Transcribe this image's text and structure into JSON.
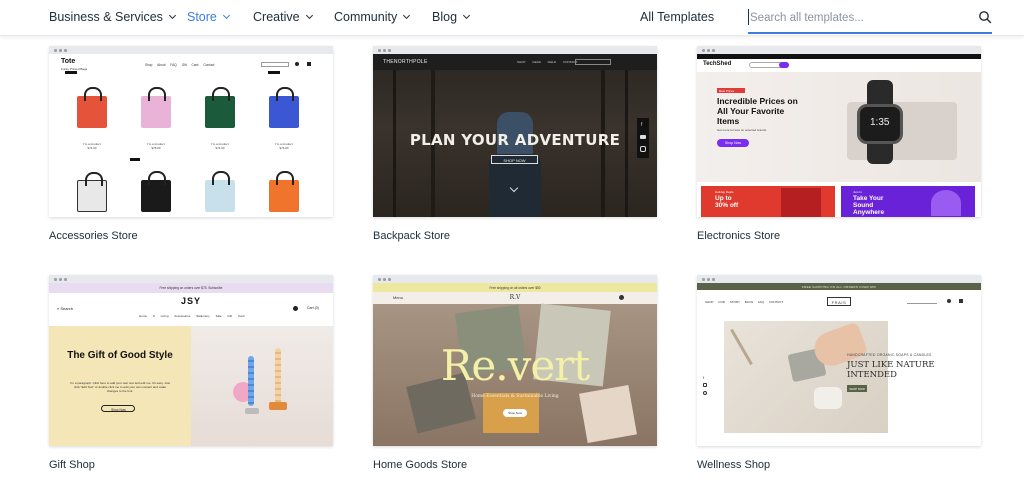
{
  "nav": {
    "items": [
      {
        "label": "Business & Services"
      },
      {
        "label": "Store"
      },
      {
        "label": "Creative"
      },
      {
        "label": "Community"
      },
      {
        "label": "Blog"
      }
    ],
    "active": "Store",
    "all_templates": "All Templates",
    "search_placeholder": "Search all templates...",
    "accent": "#3b7de0"
  },
  "templates": [
    {
      "title": "Accessories Store",
      "site": {
        "brand": "Tote",
        "tagline": "Funky Printed Bags",
        "menu": [
          "Shop",
          "About",
          "FAQ",
          "Gift Card",
          "Contact"
        ],
        "product_name": "I'm a product",
        "prices": [
          "$74.00",
          "$78.00",
          "$74.00",
          "$76.00"
        ]
      }
    },
    {
      "title": "Backpack Store",
      "site": {
        "brand": "THENORTHPOLE",
        "menu": [
          "SHOP",
          "GEAR",
          "FIELD",
          "CONTACT"
        ],
        "hero": "PLAN YOUR ADVENTURE",
        "cta": "SHOP NOW"
      }
    },
    {
      "title": "Electronics Store",
      "site": {
        "brand": "TechShed",
        "badge": "Best Prices",
        "headline": "Incredible Prices on All Your Favorite Items",
        "sub": "Get more for less on selected brands",
        "cta": "Shop Now",
        "watch_time": "1:35",
        "promo1_tag": "Holiday Deals",
        "promo1": "Up to 30% off",
        "promo2_tag": "Just In",
        "promo2": "Take Your Sound Anywhere"
      }
    },
    {
      "title": "Gift Shop",
      "site": {
        "banner": "Free shipping on orders over $75. Subscribe",
        "brand": "JSY",
        "search": "Search",
        "cart": "Cart (0)",
        "menu": [
          "Home & Living",
          "Accessories",
          "Stationery",
          "Sale",
          "Gift Card"
        ],
        "headline": "The Gift of Good Style",
        "body": "I'm a paragraph. Click here to add your own text and edit me. It's easy. Just click \"Edit Text\" or double click me to add your own content and make changes to the font.",
        "cta": "Shop Now"
      }
    },
    {
      "title": "Home Goods Store",
      "site": {
        "banner": "Free shipping on all orders over $50",
        "menu_left": "Menu",
        "logo": "R.V",
        "headline": "Re.vert",
        "sub": "Home Essentials & Sustainable Living",
        "cta": "Shop Now"
      }
    },
    {
      "title": "Wellness Shop",
      "site": {
        "banner": "FREE SHIPPING ON ALL ORDERS OVER $50",
        "brand": "FRAIS",
        "menu": [
          "SHOP",
          "OUR STORY",
          "BLOG",
          "FAQ",
          "CONTACT"
        ],
        "eyebrow": "HANDCRAFTED ORGANIC SOAPS & CANDLES",
        "headline": "JUST LIKE NATURE INTENDED",
        "cta": "SHOP NOW"
      }
    }
  ]
}
